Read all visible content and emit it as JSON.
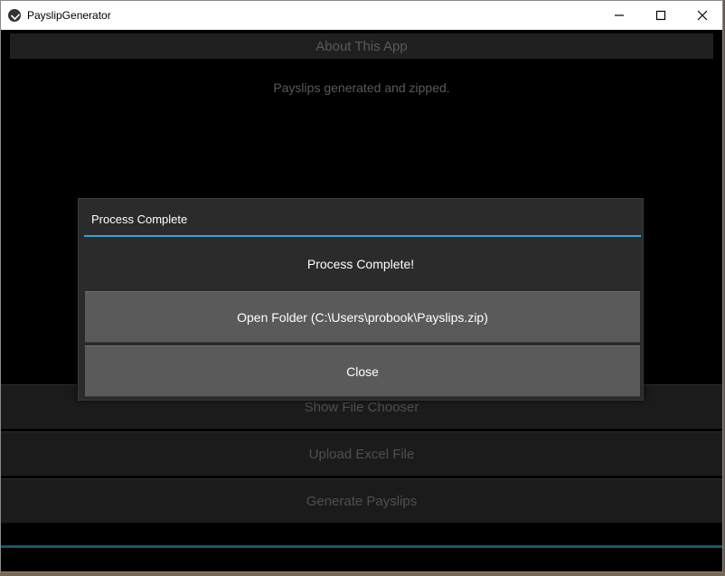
{
  "window": {
    "title": "PayslipGenerator",
    "controls": [
      "minimize-icon",
      "maximize-icon",
      "close-icon"
    ]
  },
  "main": {
    "about_label": "About This App",
    "status": "Payslips generated and zipped.",
    "buttons": {
      "show_file_chooser": "Show File Chooser",
      "upload_excel": "Upload Excel File",
      "generate": "Generate Payslips"
    },
    "progress": 1.0
  },
  "dialog": {
    "title": "Process Complete",
    "message": "Process Complete!",
    "open_folder_label": "Open Folder (C:\\Users\\probook\\Payslips.zip)",
    "close_label": "Close"
  },
  "colors": {
    "accent": "#33a3d6",
    "dialog_bg": "#2b2b2b",
    "dialog_button": "#5a5a5a",
    "disabled_text": "#4f4f4f"
  }
}
